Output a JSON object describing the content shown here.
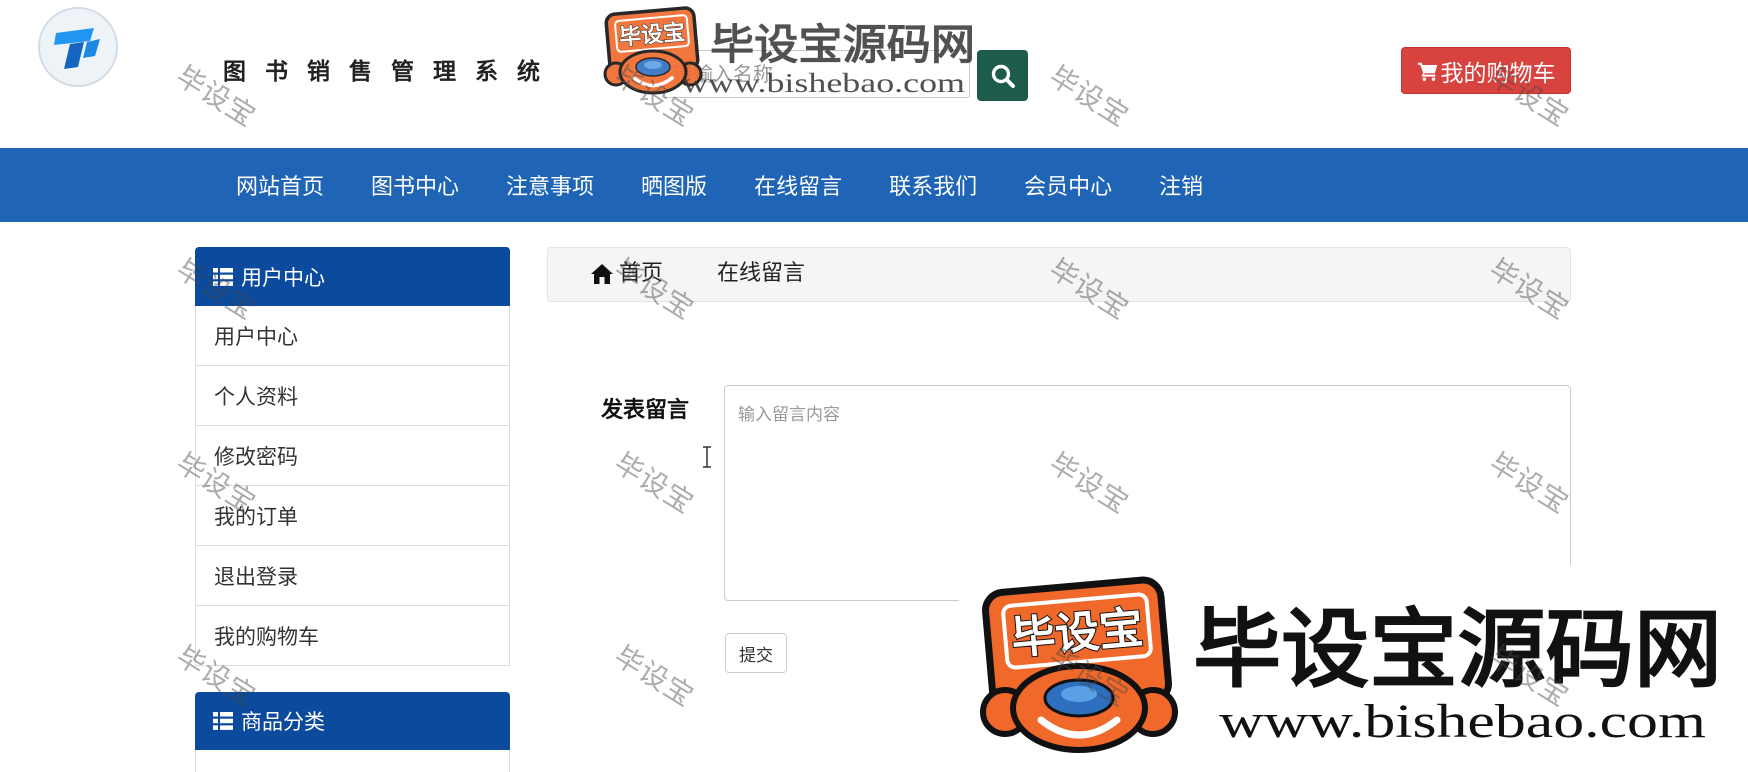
{
  "site": {
    "title": "图书销售管理系统",
    "logo_icon": "site-logo-icon"
  },
  "search": {
    "placeholder": "请输入名称",
    "value": "",
    "button_icon": "search-icon"
  },
  "cart_button": {
    "label": "我的购物车",
    "icon": "cart-icon"
  },
  "nav": {
    "items": [
      {
        "label": "网站首页"
      },
      {
        "label": "图书中心"
      },
      {
        "label": "注意事项"
      },
      {
        "label": "晒图版"
      },
      {
        "label": "在线留言"
      },
      {
        "label": "联系我们"
      },
      {
        "label": "会员中心"
      },
      {
        "label": "注销"
      }
    ]
  },
  "sidebar": {
    "user_panel": {
      "title": "用户中心",
      "icon": "list-icon",
      "items": [
        {
          "label": "用户中心"
        },
        {
          "label": "个人资料"
        },
        {
          "label": "修改密码"
        },
        {
          "label": "我的订单"
        },
        {
          "label": "退出登录"
        },
        {
          "label": "我的购物车"
        }
      ]
    },
    "category_panel": {
      "title": "商品分类",
      "icon": "list-icon"
    }
  },
  "breadcrumb": {
    "home_icon": "home-icon",
    "home": "首页",
    "current": "在线留言"
  },
  "form": {
    "label": "发表留言",
    "textarea_placeholder": "输入留言内容",
    "textarea_value": "",
    "submit_label": "提交"
  },
  "watermark": {
    "brand": "毕设宝源码网",
    "url": "www.bishebao.com",
    "badge_text": "毕设宝",
    "tile_text": "毕设宝"
  },
  "colors": {
    "nav_bg": "#1f64b5",
    "panel_head_bg": "#0b4a9c",
    "cart_bg": "#d9433f",
    "search_btn_bg": "#1d5b4a",
    "brand_orange": "#f0692a"
  }
}
